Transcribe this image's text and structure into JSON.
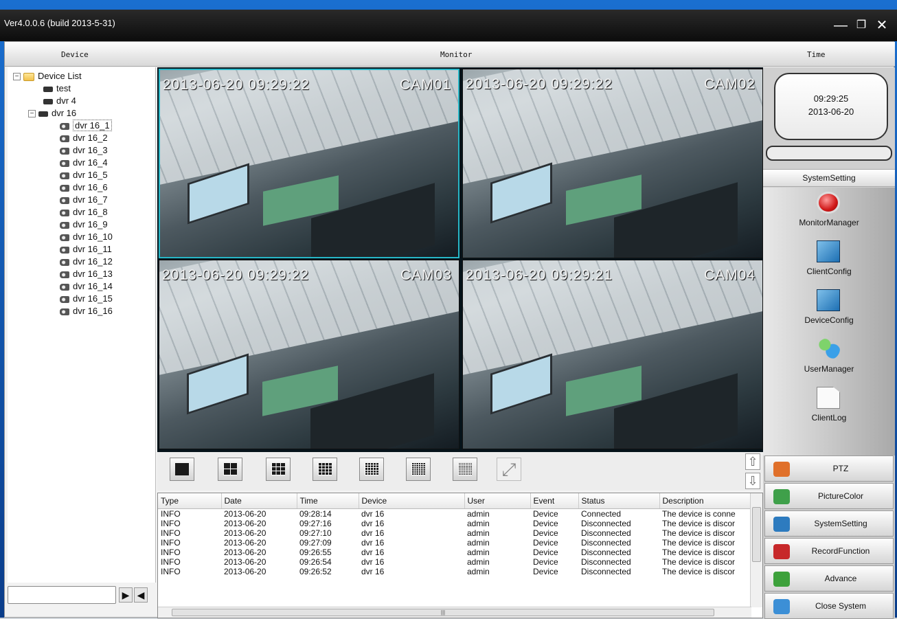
{
  "window": {
    "title": "Ver4.0.0.6 (build 2013-5-31)"
  },
  "header": {
    "device": "Device",
    "monitor": "Monitor",
    "time": "Time"
  },
  "tree": {
    "root": "Device List",
    "nodes": [
      {
        "label": "test",
        "icon": "dvr-icon",
        "level": 1
      },
      {
        "label": "dvr 4",
        "icon": "dvr-icon",
        "level": 1
      },
      {
        "label": "dvr 16",
        "icon": "dvr-icon",
        "level": 1,
        "expanded": true
      },
      {
        "label": "dvr 16_1",
        "icon": "camera-icon",
        "level": 2,
        "selected": true
      },
      {
        "label": "dvr 16_2",
        "icon": "camera-icon",
        "level": 2
      },
      {
        "label": "dvr 16_3",
        "icon": "camera-icon",
        "level": 2
      },
      {
        "label": "dvr 16_4",
        "icon": "camera-icon",
        "level": 2
      },
      {
        "label": "dvr 16_5",
        "icon": "camera-icon",
        "level": 2
      },
      {
        "label": "dvr 16_6",
        "icon": "camera-icon",
        "level": 2
      },
      {
        "label": "dvr 16_7",
        "icon": "camera-icon",
        "level": 2
      },
      {
        "label": "dvr 16_8",
        "icon": "camera-icon",
        "level": 2
      },
      {
        "label": "dvr 16_9",
        "icon": "camera-icon",
        "level": 2
      },
      {
        "label": "dvr 16_10",
        "icon": "camera-icon",
        "level": 2
      },
      {
        "label": "dvr 16_11",
        "icon": "camera-icon",
        "level": 2
      },
      {
        "label": "dvr 16_12",
        "icon": "camera-icon",
        "level": 2
      },
      {
        "label": "dvr 16_13",
        "icon": "camera-icon",
        "level": 2
      },
      {
        "label": "dvr 16_14",
        "icon": "camera-icon",
        "level": 2
      },
      {
        "label": "dvr 16_15",
        "icon": "camera-icon",
        "level": 2
      },
      {
        "label": "dvr 16_16",
        "icon": "camera-icon",
        "level": 2
      }
    ]
  },
  "cameras": [
    {
      "timestamp": "2013-06-20 09:29:22",
      "name": "CAM01",
      "active": true
    },
    {
      "timestamp": "2013-06-20 09:29:22",
      "name": "CAM02",
      "active": false
    },
    {
      "timestamp": "2013-06-20 09:29:22",
      "name": "CAM03",
      "active": false
    },
    {
      "timestamp": "2013-06-20 09:29:21",
      "name": "CAM04",
      "active": false
    }
  ],
  "layout_buttons": [
    "layout-1",
    "layout-4",
    "layout-9",
    "layout-16",
    "layout-25",
    "layout-36",
    "layout-64",
    "fullscreen"
  ],
  "log": {
    "columns": [
      "Type",
      "Date",
      "Time",
      "Device",
      "User",
      "Event",
      "Status",
      "Description"
    ],
    "rows": [
      [
        "INFO",
        "2013-06-20",
        "09:28:14",
        "dvr 16",
        "admin",
        "Device",
        "Connected",
        "The device is conne"
      ],
      [
        "INFO",
        "2013-06-20",
        "09:27:16",
        "dvr 16",
        "admin",
        "Device",
        "Disconnected",
        "The device is discor"
      ],
      [
        "INFO",
        "2013-06-20",
        "09:27:10",
        "dvr 16",
        "admin",
        "Device",
        "Disconnected",
        "The device is discor"
      ],
      [
        "INFO",
        "2013-06-20",
        "09:27:09",
        "dvr 16",
        "admin",
        "Device",
        "Disconnected",
        "The device is discor"
      ],
      [
        "INFO",
        "2013-06-20",
        "09:26:55",
        "dvr 16",
        "admin",
        "Device",
        "Disconnected",
        "The device is discor"
      ],
      [
        "INFO",
        "2013-06-20",
        "09:26:54",
        "dvr 16",
        "admin",
        "Device",
        "Disconnected",
        "The device is discor"
      ],
      [
        "INFO",
        "2013-06-20",
        "09:26:52",
        "dvr 16",
        "admin",
        "Device",
        "Disconnected",
        "The device is discor"
      ]
    ]
  },
  "clock": {
    "time": "09:29:25",
    "date": "2013-06-20"
  },
  "system": {
    "header": "SystemSetting",
    "tools": [
      {
        "label": "MonitorManager",
        "icon": "record-button-icon"
      },
      {
        "label": "ClientConfig",
        "icon": "client-config-icon"
      },
      {
        "label": "DeviceConfig",
        "icon": "device-config-icon"
      },
      {
        "label": "UserManager",
        "icon": "users-icon"
      },
      {
        "label": "ClientLog",
        "icon": "document-icon"
      }
    ]
  },
  "menu": [
    {
      "label": "PTZ",
      "icon": "ptz-icon",
      "color": "#e0702a"
    },
    {
      "label": "PictureColor",
      "icon": "color-wheel-icon",
      "color": "#3fa04a"
    },
    {
      "label": "SystemSetting",
      "icon": "settings-icon",
      "color": "#2d7bbf"
    },
    {
      "label": "RecordFunction",
      "icon": "film-icon",
      "color": "#c7282a"
    },
    {
      "label": "Advance",
      "icon": "down-arrow-icon",
      "color": "#3da13b"
    },
    {
      "label": "Close System",
      "icon": "close-system-icon",
      "color": "#3c8fd6"
    }
  ],
  "colors": {
    "active_tile_border": "#27b7c7",
    "titlebar": "#111111",
    "accent_blue": "#1a6fd0"
  }
}
